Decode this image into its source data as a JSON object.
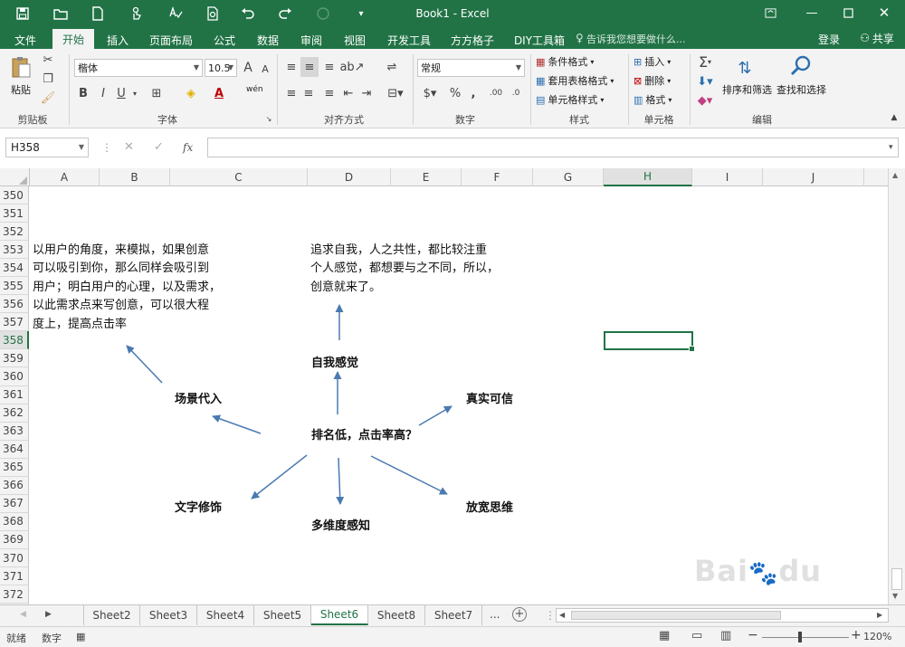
{
  "window": {
    "title": "Book1 - Excel",
    "qat_icons": [
      "save-icon",
      "open-folder-icon",
      "new-file-icon",
      "touch-mode-icon",
      "spelling-icon",
      "print-preview-icon",
      "undo-icon",
      "redo-icon",
      "customize-icon"
    ]
  },
  "tabs": [
    "文件",
    "开始",
    "插入",
    "页面布局",
    "公式",
    "数据",
    "审阅",
    "视图",
    "开发工具",
    "方方格子",
    "DIY工具箱"
  ],
  "tellme_placeholder": "告诉我您想要做什么...",
  "login": "登录",
  "share": "共享",
  "ribbon": {
    "clipboard": {
      "paste": "粘贴",
      "label": "剪贴板"
    },
    "font": {
      "name": "楷体",
      "size": "10.5",
      "bold": "B",
      "italic": "I",
      "underline": "U",
      "phonetic": "wén",
      "label": "字体"
    },
    "alignment": {
      "label": "对齐方式"
    },
    "number": {
      "format": "常规",
      "label": "数字"
    },
    "styles": {
      "conditional": "条件格式",
      "table": "套用表格格式",
      "cell": "单元格样式",
      "label": "样式"
    },
    "cells": {
      "insert": "插入",
      "delete": "删除",
      "format": "格式",
      "label": "单元格"
    },
    "editing": {
      "sum": "Σ",
      "sort": "排序和筛选",
      "find": "查找和选择",
      "label": "编辑"
    }
  },
  "formula_bar": {
    "name_box": "H358",
    "fx": "fx",
    "value": ""
  },
  "columns": [
    "A",
    "B",
    "C",
    "D",
    "E",
    "F",
    "G",
    "H",
    "I",
    "J"
  ],
  "selected_column": "H",
  "rows": [
    "350",
    "351",
    "352",
    "353",
    "354",
    "355",
    "356",
    "357",
    "358",
    "359",
    "360",
    "361",
    "362",
    "363",
    "364",
    "365",
    "366",
    "367",
    "368",
    "369",
    "370",
    "371",
    "372"
  ],
  "selected_row": "358",
  "notes": {
    "left": [
      "以用户的角度，来模拟，如果创意",
      "可以吸引到你，那么同样会吸引到",
      "用户；明白用户的心理，以及需求，",
      "以此需求点来写创意，可以很大程",
      "度上，提高点击率"
    ],
    "right": [
      "追求自我，人之共性，都比较注重",
      "个人感觉，都想要与之不同，所以，",
      "创意就来了。"
    ]
  },
  "mindmap": {
    "center": "排名低，点击率高？",
    "branches": [
      "自我感觉",
      "场景代入",
      "真实可信",
      "文字修饰",
      "多维度感知",
      "放宽思维"
    ],
    "arrow_color": "#4a7ab0"
  },
  "sheets": [
    "Sheet2",
    "Sheet3",
    "Sheet4",
    "Sheet5",
    "Sheet6",
    "Sheet8",
    "Sheet7"
  ],
  "active_sheet": "Sheet6",
  "status": {
    "ready": "就绪",
    "mode": "数字",
    "zoom": "120%"
  },
  "colors": {
    "excel_green": "#217346",
    "ribbon_bg": "#f3f3f3"
  }
}
